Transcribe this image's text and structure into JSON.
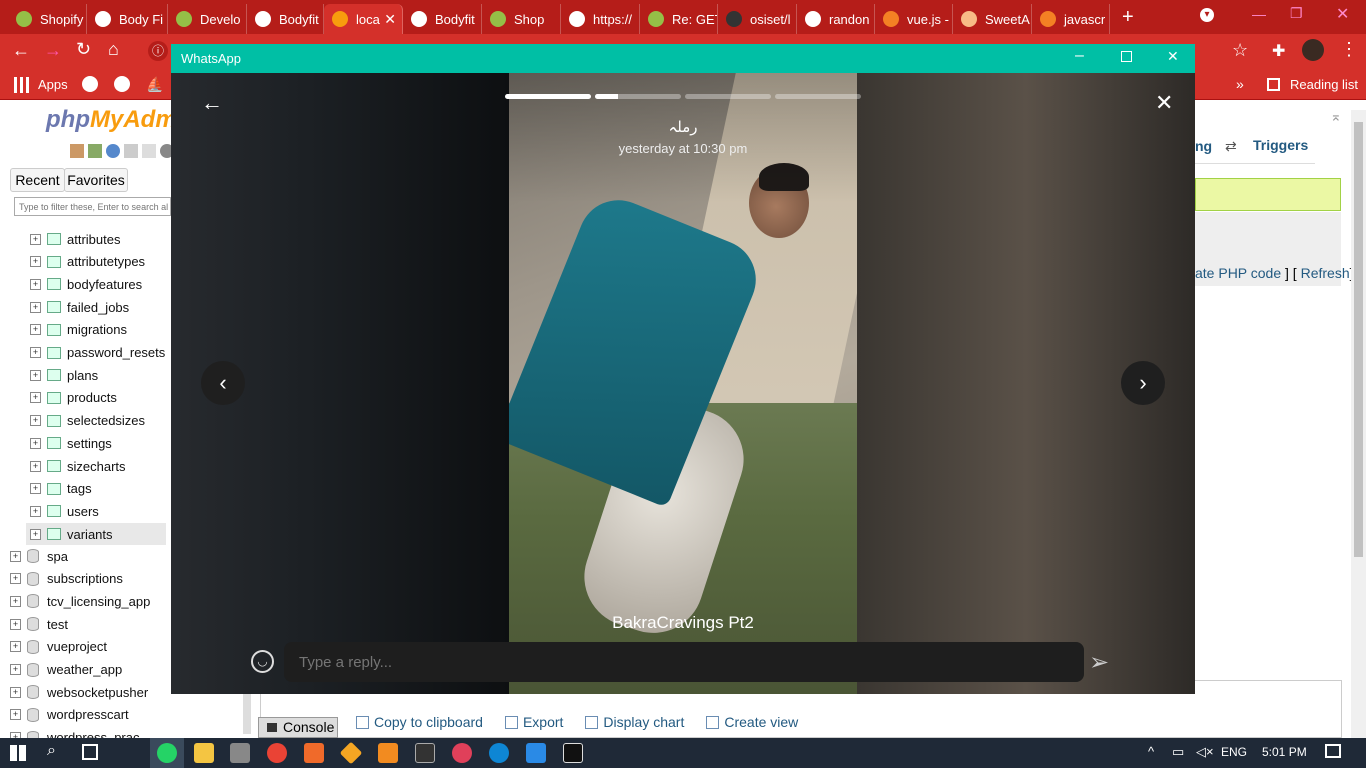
{
  "browser": {
    "tabs": [
      {
        "label": "Shopify",
        "icon": "shopify-icon"
      },
      {
        "label": "Body Fi",
        "icon": "globe-icon"
      },
      {
        "label": "Develo",
        "icon": "shopify-icon"
      },
      {
        "label": "Bodyfit",
        "icon": "globe-icon"
      },
      {
        "label": "loca",
        "icon": "pma-icon",
        "active": true
      },
      {
        "label": "Bodyfit",
        "icon": "globe-icon"
      },
      {
        "label": "Shop",
        "icon": "shopify-icon"
      },
      {
        "label": "https://",
        "icon": "globe-icon"
      },
      {
        "label": "Re: GET",
        "icon": "shopify-icon"
      },
      {
        "label": "osiset/l",
        "icon": "github-icon"
      },
      {
        "label": "randon",
        "icon": "google-icon"
      },
      {
        "label": "vue.js -",
        "icon": "stack-icon"
      },
      {
        "label": "SweetA",
        "icon": "sweetalert-icon"
      },
      {
        "label": "javascr",
        "icon": "stack-icon"
      }
    ],
    "new_tab": "+",
    "bookmarks": {
      "apps": "Apps",
      "reading_list": "Reading list",
      "more": "»"
    }
  },
  "pma": {
    "logo_php": "php",
    "logo_myadmin": "MyAdm",
    "recent": "Recent",
    "favorites": "Favorites",
    "filter_placeholder": "Type to filter these, Enter to search al",
    "tables": [
      "attributes",
      "attributetypes",
      "bodyfeatures",
      "failed_jobs",
      "migrations",
      "password_resets",
      "plans",
      "products",
      "selectedsizes",
      "settings",
      "sizecharts",
      "tags",
      "users",
      "variants"
    ],
    "databases": [
      "spa",
      "subscriptions",
      "tcv_licensing_app",
      "test",
      "vueproject",
      "weather_app",
      "websocketpusher",
      "wordpresscart",
      "wordpress_prac"
    ],
    "tab_partial": "ng",
    "triggers": "Triggers",
    "php_code": "ate PHP code",
    "refresh": "Refresh",
    "bracket_mid": " ] [ ",
    "bracket_end": "]",
    "console": "Console",
    "bottom_links": [
      "Copy to clipboard",
      "Export",
      "Display chart",
      "Create view"
    ]
  },
  "whatsapp": {
    "window_title": "WhatsApp",
    "status_name": "رملہ",
    "status_time": "yesterday at 10:30 pm",
    "caption": "BakraCravings Pt2",
    "reply_placeholder": "Type a reply...",
    "progress": [
      1.0,
      0.27,
      0,
      0
    ]
  },
  "taskbar": {
    "lang": "ENG",
    "time": "5:01 PM"
  },
  "colors": {
    "chrome_red": "#d4302a",
    "whatsapp_teal": "#00bfa5",
    "taskbar": "#1f2937"
  }
}
